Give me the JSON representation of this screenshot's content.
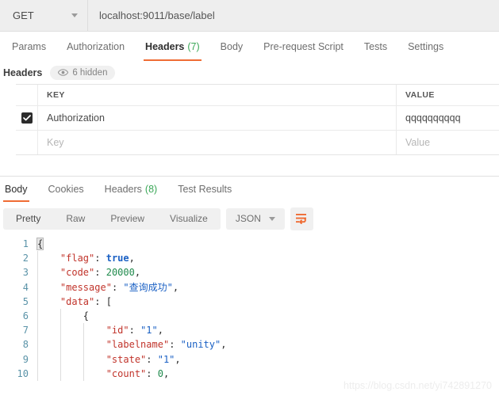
{
  "request_bar": {
    "method": "GET",
    "method_icon": "chevron-down-icon",
    "url": "localhost:9011/base/label"
  },
  "request_tabs": [
    {
      "label": "Params",
      "count": "",
      "active": false
    },
    {
      "label": "Authorization",
      "count": "",
      "active": false
    },
    {
      "label": "Headers",
      "count": "(7)",
      "active": true
    },
    {
      "label": "Body",
      "count": "",
      "active": false
    },
    {
      "label": "Pre-request Script",
      "count": "",
      "active": false
    },
    {
      "label": "Tests",
      "count": "",
      "active": false
    },
    {
      "label": "Settings",
      "count": "",
      "active": false
    }
  ],
  "headers_section": {
    "title": "Headers",
    "hidden_badge": "6 hidden",
    "hidden_icon": "eye-icon",
    "columns": {
      "key": "KEY",
      "value": "VALUE"
    },
    "rows": [
      {
        "checked": true,
        "key": "Authorization",
        "value": "qqqqqqqqqq",
        "key_placeholder": "",
        "value_placeholder": ""
      },
      {
        "checked": false,
        "key": "",
        "value": "",
        "key_placeholder": "Key",
        "value_placeholder": "Value"
      }
    ]
  },
  "response_tabs": [
    {
      "label": "Body",
      "count": "",
      "active": true
    },
    {
      "label": "Cookies",
      "count": "",
      "active": false
    },
    {
      "label": "Headers",
      "count": "(8)",
      "active": false
    },
    {
      "label": "Test Results",
      "count": "",
      "active": false
    }
  ],
  "view_toolbar": {
    "modes": [
      "Pretty",
      "Raw",
      "Preview",
      "Visualize"
    ],
    "active_mode": "Pretty",
    "format": "JSON",
    "format_icon": "chevron-down-icon",
    "wrap_icon": "wrap-lines-icon"
  },
  "response_body": {
    "lines": [
      {
        "n": "1",
        "indent": 0,
        "parts": [
          {
            "t": "punc",
            "v": "{"
          }
        ]
      },
      {
        "n": "2",
        "indent": 1,
        "parts": [
          {
            "t": "key",
            "v": "\"flag\""
          },
          {
            "t": "punc",
            "v": ": "
          },
          {
            "t": "bool",
            "v": "true"
          },
          {
            "t": "punc",
            "v": ","
          }
        ]
      },
      {
        "n": "3",
        "indent": 1,
        "parts": [
          {
            "t": "key",
            "v": "\"code\""
          },
          {
            "t": "punc",
            "v": ": "
          },
          {
            "t": "num",
            "v": "20000"
          },
          {
            "t": "punc",
            "v": ","
          }
        ]
      },
      {
        "n": "4",
        "indent": 1,
        "parts": [
          {
            "t": "key",
            "v": "\"message\""
          },
          {
            "t": "punc",
            "v": ": "
          },
          {
            "t": "str",
            "v": "\"查询成功\""
          },
          {
            "t": "punc",
            "v": ","
          }
        ]
      },
      {
        "n": "5",
        "indent": 1,
        "parts": [
          {
            "t": "key",
            "v": "\"data\""
          },
          {
            "t": "punc",
            "v": ": ["
          }
        ]
      },
      {
        "n": "6",
        "indent": 2,
        "parts": [
          {
            "t": "punc",
            "v": "{"
          }
        ]
      },
      {
        "n": "7",
        "indent": 3,
        "parts": [
          {
            "t": "key",
            "v": "\"id\""
          },
          {
            "t": "punc",
            "v": ": "
          },
          {
            "t": "str",
            "v": "\"1\""
          },
          {
            "t": "punc",
            "v": ","
          }
        ]
      },
      {
        "n": "8",
        "indent": 3,
        "parts": [
          {
            "t": "key",
            "v": "\"labelname\""
          },
          {
            "t": "punc",
            "v": ": "
          },
          {
            "t": "str",
            "v": "\"unity\""
          },
          {
            "t": "punc",
            "v": ","
          }
        ]
      },
      {
        "n": "9",
        "indent": 3,
        "parts": [
          {
            "t": "key",
            "v": "\"state\""
          },
          {
            "t": "punc",
            "v": ": "
          },
          {
            "t": "str",
            "v": "\"1\""
          },
          {
            "t": "punc",
            "v": ","
          }
        ]
      },
      {
        "n": "10",
        "indent": 3,
        "parts": [
          {
            "t": "key",
            "v": "\"count\""
          },
          {
            "t": "punc",
            "v": ": "
          },
          {
            "t": "num",
            "v": "0"
          },
          {
            "t": "punc",
            "v": ","
          }
        ]
      }
    ]
  },
  "watermark": "https://blog.csdn.net/yi742891270",
  "colors": {
    "accent_orange": "#ef6c34",
    "count_green": "#3aa757",
    "json_key": "#c1342b",
    "json_string": "#1a60c4",
    "json_number": "#1f8a4c",
    "gutter": "#5a93a8"
  }
}
